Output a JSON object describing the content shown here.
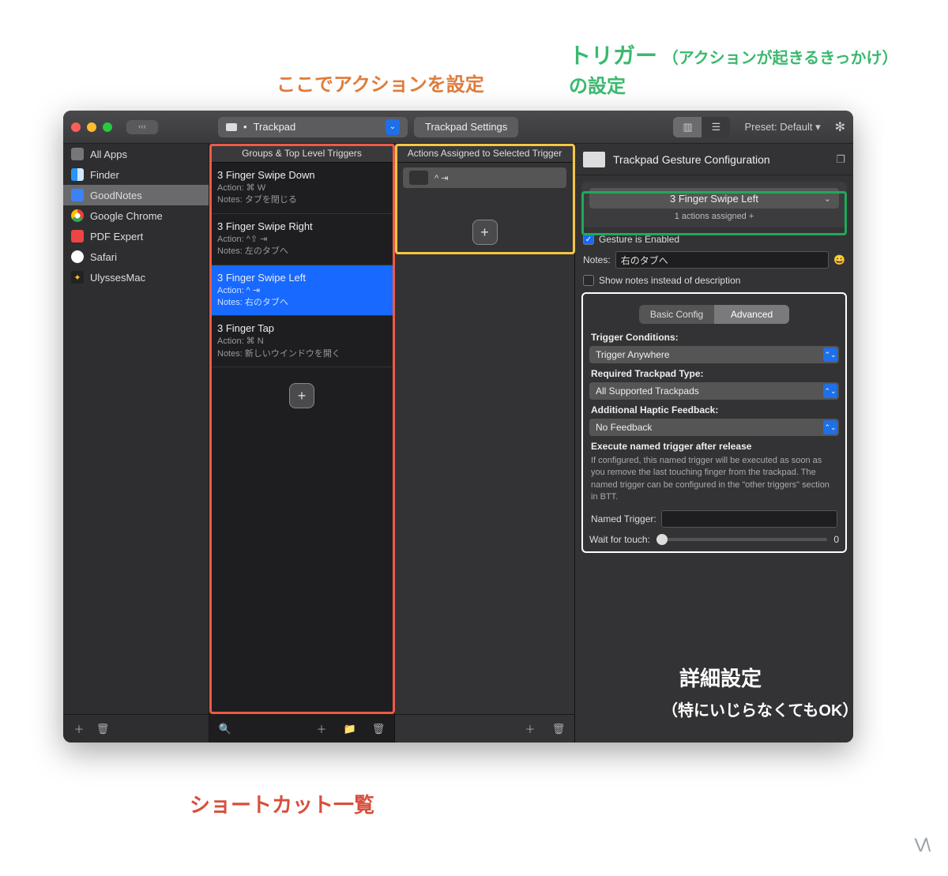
{
  "annotations": {
    "action_label": "ここでアクションを設定",
    "trigger_label_1": "トリガー",
    "trigger_label_2": "（アクションが起きるきっかけ）",
    "trigger_label_3": "の設定",
    "detail_title": "詳細設定",
    "detail_sub": "（特にいじらなくてもOK）",
    "shortcut_list": "ショートカット一覧"
  },
  "toolbar": {
    "device": "Trackpad",
    "settings_btn": "Trackpad Settings",
    "preset": "Preset: Default ▾"
  },
  "sidebar": {
    "apps": [
      {
        "label": "All Apps",
        "icon": "grid"
      },
      {
        "label": "Finder",
        "icon": "finder"
      },
      {
        "label": "GoodNotes",
        "icon": "good",
        "selected": true
      },
      {
        "label": "Google Chrome",
        "icon": "chrome"
      },
      {
        "label": "PDF Expert",
        "icon": "pdf"
      },
      {
        "label": "Safari",
        "icon": "safari"
      },
      {
        "label": "UlyssesMac",
        "icon": "uly",
        "glyph": "✦"
      }
    ]
  },
  "col_triggers": {
    "header": "Groups & Top Level Triggers",
    "items": [
      {
        "title": "3 Finger Swipe Down",
        "action": "Action: ⌘ W",
        "notes": "Notes: タブを閉じる"
      },
      {
        "title": "3 Finger Swipe Right",
        "action": "Action: ^⇧ ⇥",
        "notes": "Notes: 左のタブへ"
      },
      {
        "title": "3 Finger Swipe Left",
        "action": "Action: ^ ⇥",
        "notes": "Notes: 右のタブへ",
        "selected": true
      },
      {
        "title": "3 Finger Tap",
        "action": "Action: ⌘ N",
        "notes": "Notes: 新しいウインドウを開く"
      }
    ]
  },
  "col_actions": {
    "header": "Actions Assigned to Selected Trigger",
    "chip": "^ ⇥"
  },
  "config": {
    "title": "Trackpad Gesture Configuration",
    "gesture_name": "3 Finger Swipe Left",
    "gesture_sub": "1 actions assigned +",
    "enabled_label": "Gesture is Enabled",
    "notes_label": "Notes:",
    "notes_value": "右のタブへ",
    "show_notes_label": "Show notes instead of description",
    "tabs": {
      "basic": "Basic Config",
      "advanced": "Advanced"
    },
    "trigger_cond_label": "Trigger Conditions:",
    "trigger_cond_value": "Trigger Anywhere",
    "trackpad_type_label": "Required Trackpad Type:",
    "trackpad_type_value": "All Supported Trackpads",
    "haptic_label": "Additional Haptic Feedback:",
    "haptic_value": "No Feedback",
    "execute_label": "Execute named trigger after release",
    "execute_desc": "If configured, this named trigger will be executed as soon as you remove the last touching finger from the trackpad. The named trigger can be configured in the \"other triggers\" section in BTT.",
    "named_trigger_label": "Named Trigger:",
    "wait_label": "Wait for touch:",
    "wait_value": "0"
  }
}
